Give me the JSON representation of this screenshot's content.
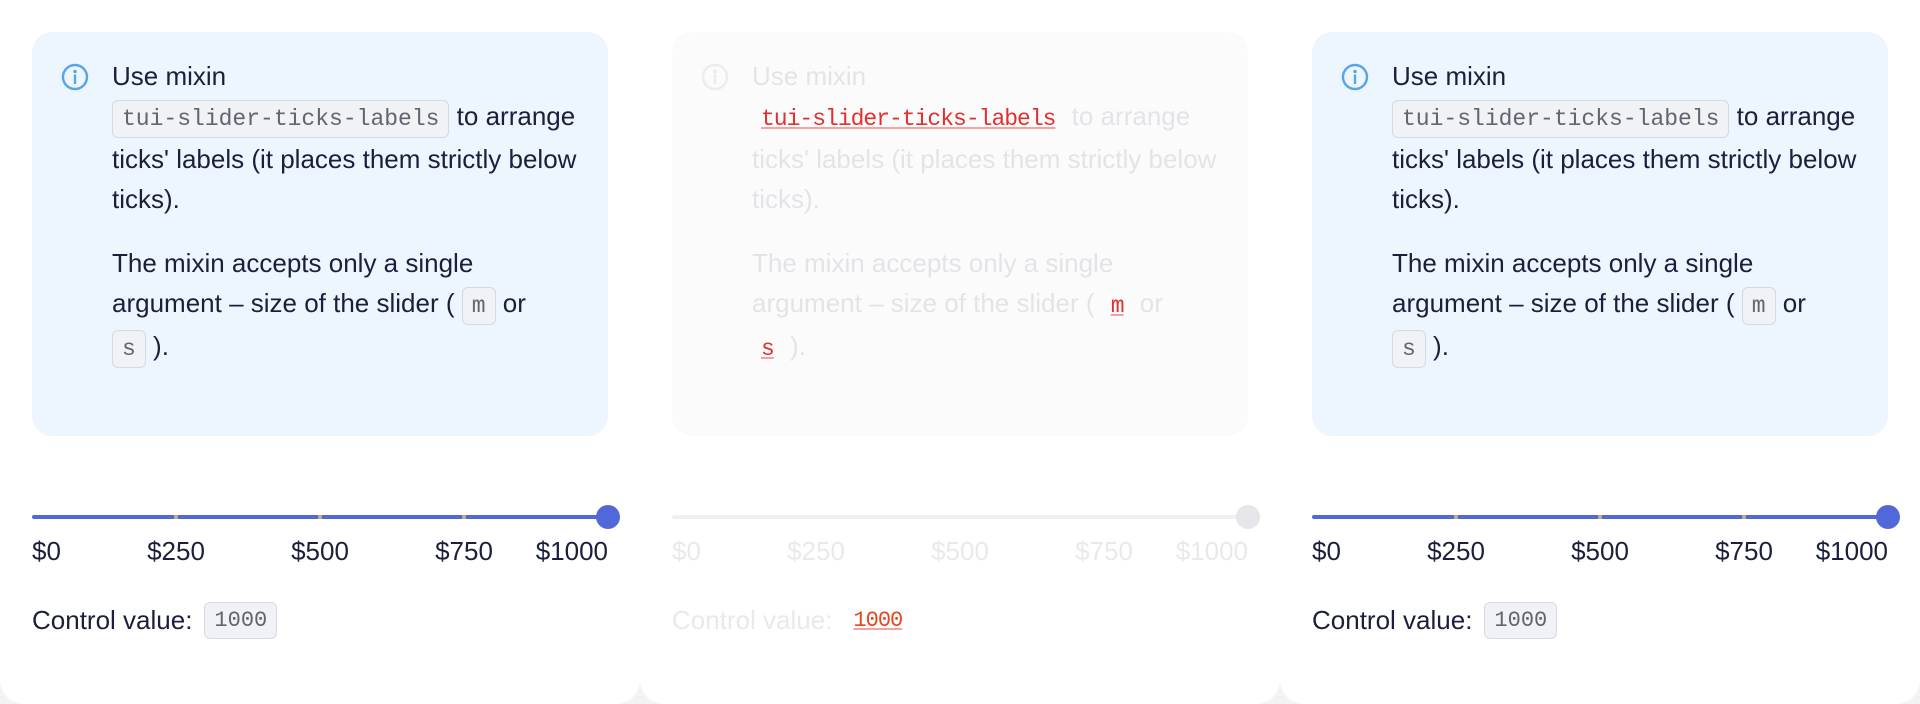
{
  "panes": [
    {
      "state": "default",
      "notice": {
        "line1": "Use mixin",
        "mixin_code": "tui-slider-ticks-labels",
        "after_code": " to arrange ticks' labels (it places them strictly below ticks).",
        "p2_start": "The mixin accepts only a single argument – size of the slider ( ",
        "size_m": "m",
        "or": " or ",
        "size_s": "s",
        "end": " )."
      },
      "slider": {
        "value_fraction": 1.0,
        "ticks": [
          "$0",
          "$250",
          "$500",
          "$750",
          "$1000"
        ]
      },
      "control_label": "Control value:",
      "control_value": "1000"
    },
    {
      "state": "disabled",
      "notice": {
        "line1": "Use mixin",
        "mixin_code": "tui-slider-ticks-labels",
        "after_code": " to arrange ticks' labels (it places them strictly below ticks).",
        "p2_start": "The mixin accepts only a single argument – size of the slider ( ",
        "size_m": "m",
        "or": " or ",
        "size_s": "s",
        "end": " )."
      },
      "slider": {
        "value_fraction": 1.0,
        "ticks": [
          "$0",
          "$250",
          "$500",
          "$750",
          "$1000"
        ]
      },
      "control_label": "Control value:",
      "control_value": "1000"
    },
    {
      "state": "default",
      "notice": {
        "line1": "Use mixin",
        "mixin_code": "tui-slider-ticks-labels",
        "after_code": " to arrange ticks' labels (it places them strictly below ticks).",
        "p2_start": "The mixin accepts only a single argument – size of the slider ( ",
        "size_m": "m",
        "or": " or ",
        "size_s": "s",
        "end": " )."
      },
      "slider": {
        "value_fraction": 1.0,
        "ticks": [
          "$0",
          "$250",
          "$500",
          "$750",
          "$1000"
        ]
      },
      "control_label": "Control value:",
      "control_value": "1000"
    }
  ],
  "colors": {
    "accent": "#5168d8",
    "notice_bg": "#edf5ff",
    "text": "#1b1f3b",
    "tick": "#b5ae8a",
    "error_red": "#e23030"
  },
  "icons": {
    "notice": "info-circle-icon"
  }
}
